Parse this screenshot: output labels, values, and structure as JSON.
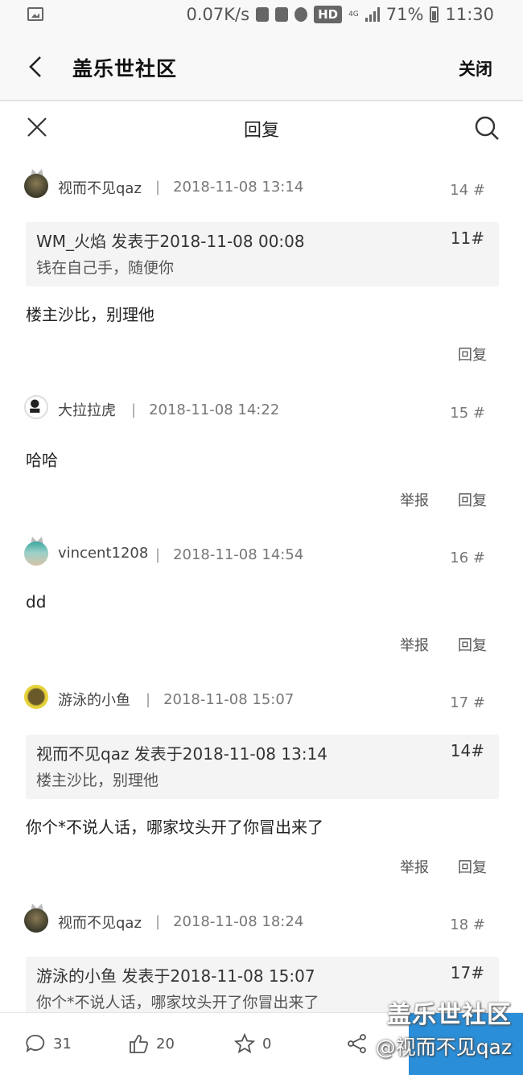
{
  "status_bar": {
    "speed": "0.07K/s",
    "hd": "HD",
    "network": "4G",
    "battery": "71%",
    "time": "11:30"
  },
  "title_bar": {
    "title": "盖乐世社区",
    "close_label": "关闭"
  },
  "sub_bar": {
    "title": "回复"
  },
  "actions": {
    "report": "举报",
    "reply": "回复"
  },
  "posts": [
    {
      "username": "视而不见qaz",
      "date": "2018-11-08 13:14",
      "floor": "14 #",
      "quote": {
        "header": "WM_火焰 发表于2018-11-08 00:08",
        "floor": "11#",
        "text": "钱在自己手，随便你"
      },
      "content": "楼主沙比，别理他"
    },
    {
      "username": "大拉拉虎",
      "date": "2018-11-08 14:22",
      "floor": "15 #",
      "content": "哈哈"
    },
    {
      "username": "vincent1208",
      "date": "2018-11-08 14:54",
      "floor": "16 #",
      "content": "dd"
    },
    {
      "username": "游泳的小鱼",
      "date": "2018-11-08 15:07",
      "floor": "17 #",
      "quote": {
        "header": "视而不见qaz 发表于2018-11-08 13:14",
        "floor": "14#",
        "text": "楼主沙比，别理他"
      },
      "content": "你个*不说人话，哪家坟头开了你冒出来了"
    },
    {
      "username": "视而不见qaz",
      "date": "2018-11-08 18:24",
      "floor": "18 #",
      "quote": {
        "header": "游泳的小鱼 发表于2018-11-08 15:07",
        "floor": "17#",
        "text": "你个*不说人话，哪家坟头开了你冒出来了"
      }
    }
  ],
  "bottom_bar": {
    "comments": "31",
    "likes": "20",
    "favorites": "0"
  },
  "watermark": {
    "line1": "盖乐世社区",
    "line2": "@视而不见qaz"
  },
  "colors": {
    "accent": "#2a8ed8"
  }
}
